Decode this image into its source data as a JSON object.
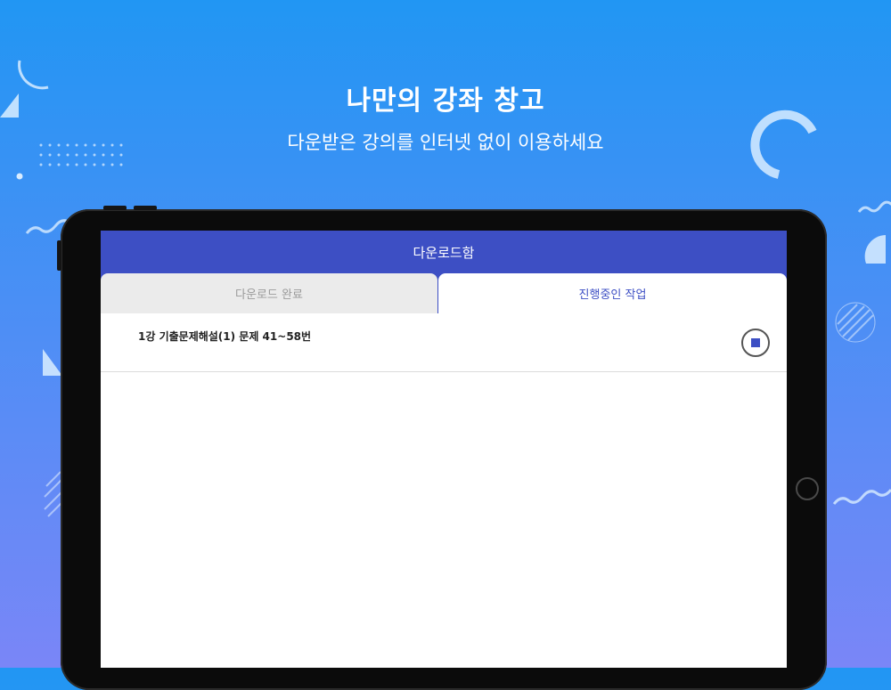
{
  "hero": {
    "title": "나만의 강좌 창고",
    "subtitle": "다운받은 강의를 인터넷 없이 이용하세요"
  },
  "app": {
    "title": "다운로드함",
    "tabs": [
      {
        "label": "다운로드 완료",
        "selected": false
      },
      {
        "label": "진행중인 작업",
        "selected": true
      }
    ],
    "downloads": [
      {
        "title": "1강 기출문제해설(1)  문제 41~58번",
        "action_icon": "stop-icon"
      }
    ]
  },
  "colors": {
    "accent": "#3d4fc4",
    "background_top": "#2196f3",
    "background_bottom": "#7a86f7",
    "inactive_tab": "#ebebeb"
  }
}
